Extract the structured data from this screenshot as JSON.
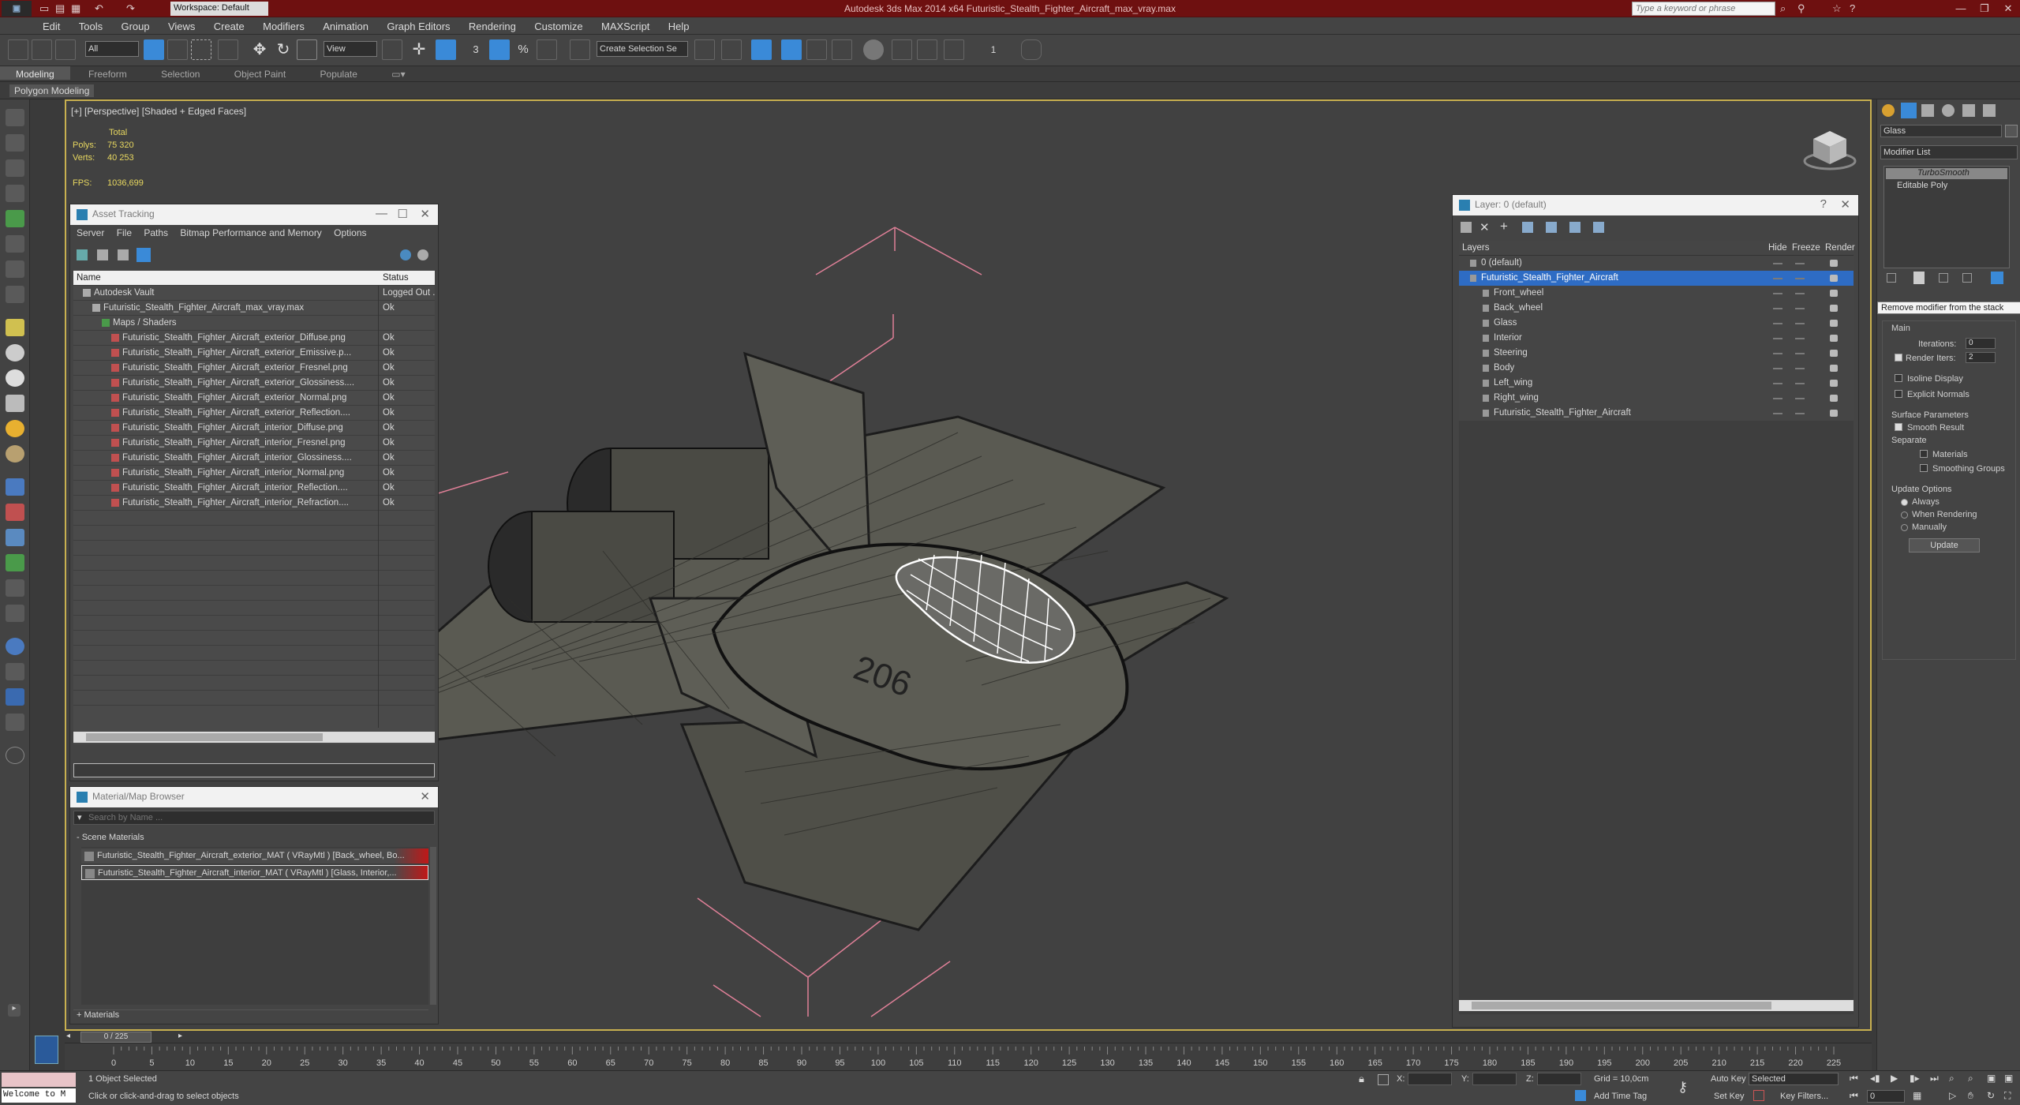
{
  "app": {
    "title": "Autodesk 3ds Max  2014 x64     Futuristic_Stealth_Fighter_Aircraft_max_vray.max",
    "workspace": "Workspace: Default",
    "search_placeholder": "Type a keyword or phrase"
  },
  "menu": [
    "Edit",
    "Tools",
    "Group",
    "Views",
    "Create",
    "Modifiers",
    "Animation",
    "Graph Editors",
    "Rendering",
    "Customize",
    "MAXScript",
    "Help"
  ],
  "toolbar": {
    "selection_filter": "All",
    "ref_coord": "View",
    "named_selection": "Create Selection Se",
    "snap_value": "3",
    "percent_label": "%",
    "number_one": "1"
  },
  "ribbon": {
    "tabs": [
      "Modeling",
      "Freeform",
      "Selection",
      "Object Paint",
      "Populate"
    ],
    "active": "Modeling",
    "sub_label": "Polygon Modeling"
  },
  "viewport": {
    "label": "[+] [Perspective] [Shaded + Edged Faces]",
    "stats": {
      "total_label": "Total",
      "polys_label": "Polys:",
      "polys": "75 320",
      "verts_label": "Verts:",
      "verts": "40 253",
      "fps_label": "FPS:",
      "fps": "1036,699"
    },
    "hull_number": "206"
  },
  "asset_tracking": {
    "title": "Asset Tracking",
    "menu": [
      "Server",
      "File",
      "Paths",
      "Bitmap Performance and Memory",
      "Options"
    ],
    "columns": [
      "Name",
      "Status"
    ],
    "rows": [
      {
        "name": "Autodesk Vault",
        "status": "Logged Out ...",
        "indent": 1
      },
      {
        "name": "Futuristic_Stealth_Fighter_Aircraft_max_vray.max",
        "status": "Ok",
        "indent": 2
      },
      {
        "name": "Maps / Shaders",
        "status": "",
        "indent": 3
      },
      {
        "name": "Futuristic_Stealth_Fighter_Aircraft_exterior_Diffuse.png",
        "status": "Ok",
        "indent": 4
      },
      {
        "name": "Futuristic_Stealth_Fighter_Aircraft_exterior_Emissive.p...",
        "status": "Ok",
        "indent": 4
      },
      {
        "name": "Futuristic_Stealth_Fighter_Aircraft_exterior_Fresnel.png",
        "status": "Ok",
        "indent": 4
      },
      {
        "name": "Futuristic_Stealth_Fighter_Aircraft_exterior_Glossiness....",
        "status": "Ok",
        "indent": 4
      },
      {
        "name": "Futuristic_Stealth_Fighter_Aircraft_exterior_Normal.png",
        "status": "Ok",
        "indent": 4
      },
      {
        "name": "Futuristic_Stealth_Fighter_Aircraft_exterior_Reflection....",
        "status": "Ok",
        "indent": 4
      },
      {
        "name": "Futuristic_Stealth_Fighter_Aircraft_interior_Diffuse.png",
        "status": "Ok",
        "indent": 4
      },
      {
        "name": "Futuristic_Stealth_Fighter_Aircraft_interior_Fresnel.png",
        "status": "Ok",
        "indent": 4
      },
      {
        "name": "Futuristic_Stealth_Fighter_Aircraft_interior_Glossiness....",
        "status": "Ok",
        "indent": 4
      },
      {
        "name": "Futuristic_Stealth_Fighter_Aircraft_interior_Normal.png",
        "status": "Ok",
        "indent": 4
      },
      {
        "name": "Futuristic_Stealth_Fighter_Aircraft_interior_Reflection....",
        "status": "Ok",
        "indent": 4
      },
      {
        "name": "Futuristic_Stealth_Fighter_Aircraft_interior_Refraction....",
        "status": "Ok",
        "indent": 4
      }
    ]
  },
  "material_browser": {
    "title": "Material/Map Browser",
    "search_placeholder": "Search by Name ...",
    "section": "- Scene Materials",
    "items": [
      "Futuristic_Stealth_Fighter_Aircraft_exterior_MAT  ( VRayMtl ) [Back_wheel, Bo...",
      "Futuristic_Stealth_Fighter_Aircraft_interior_MAT  ( VRayMtl ) [Glass, Interior,..."
    ],
    "footer": "+ Materials"
  },
  "layer_manager": {
    "title": "Layer: 0 (default)",
    "columns": [
      "Layers",
      "Hide",
      "Freeze",
      "Render"
    ],
    "layers": [
      {
        "name": "0 (default)",
        "indent": 0,
        "selected": false
      },
      {
        "name": "Futuristic_Stealth_Fighter_Aircraft",
        "indent": 0,
        "selected": true
      },
      {
        "name": "Front_wheel",
        "indent": 1,
        "selected": false
      },
      {
        "name": "Back_wheel",
        "indent": 1,
        "selected": false
      },
      {
        "name": "Glass",
        "indent": 1,
        "selected": false
      },
      {
        "name": "Interior",
        "indent": 1,
        "selected": false
      },
      {
        "name": "Steering",
        "indent": 1,
        "selected": false
      },
      {
        "name": "Body",
        "indent": 1,
        "selected": false
      },
      {
        "name": "Left_wing",
        "indent": 1,
        "selected": false
      },
      {
        "name": "Right_wing",
        "indent": 1,
        "selected": false
      },
      {
        "name": "Futuristic_Stealth_Fighter_Aircraft",
        "indent": 1,
        "selected": false
      }
    ]
  },
  "command_panel": {
    "object_name": "Glass",
    "modifier_list": "Modifier List",
    "stack": [
      "TurboSmooth",
      "Editable Poly"
    ],
    "tooltip": "Remove modifier from the stack",
    "main_label": "Main",
    "iterations_label": "Iterations:",
    "iterations": "0",
    "render_iters_label": "Render Iters:",
    "render_iters": "2",
    "isoline": "Isoline Display",
    "explicit": "Explicit Normals",
    "surface_label": "Surface Parameters",
    "smooth_result": "Smooth Result",
    "separate_label": "Separate",
    "materials": "Materials",
    "smoothing_groups": "Smoothing Groups",
    "update_options": "Update Options",
    "always": "Always",
    "when_rendering": "When Rendering",
    "manually": "Manually",
    "update_btn": "Update"
  },
  "timeline": {
    "frame": "0 / 225",
    "ticks": [
      "0",
      "5",
      "10",
      "15",
      "20",
      "25",
      "30",
      "35",
      "40",
      "45",
      "50",
      "55",
      "60",
      "65",
      "70",
      "75",
      "80",
      "85",
      "90",
      "95",
      "100",
      "105",
      "110",
      "115",
      "120",
      "125",
      "130",
      "135",
      "140",
      "145",
      "150",
      "155",
      "160",
      "165",
      "170",
      "175",
      "180",
      "185",
      "190",
      "195",
      "200",
      "205",
      "210",
      "215",
      "220",
      "225"
    ]
  },
  "status": {
    "welcome": "Welcome to M",
    "selected": "1 Object Selected",
    "prompt": "Click or click-and-drag to select objects",
    "x_label": "X:",
    "y_label": "Y:",
    "z_label": "Z:",
    "grid": "Grid = 10,0cm",
    "auto_key": "Auto Key",
    "selected_dd": "Selected",
    "set_key": "Set Key",
    "key_filters": "Key Filters...",
    "add_time_tag": "Add Time Tag",
    "frame_field": "0"
  },
  "colors": {
    "titlebar": "#6e1010",
    "selection": "#2e6cc4",
    "viewport_border": "#c8b050",
    "stats_text": "#e8d860"
  }
}
